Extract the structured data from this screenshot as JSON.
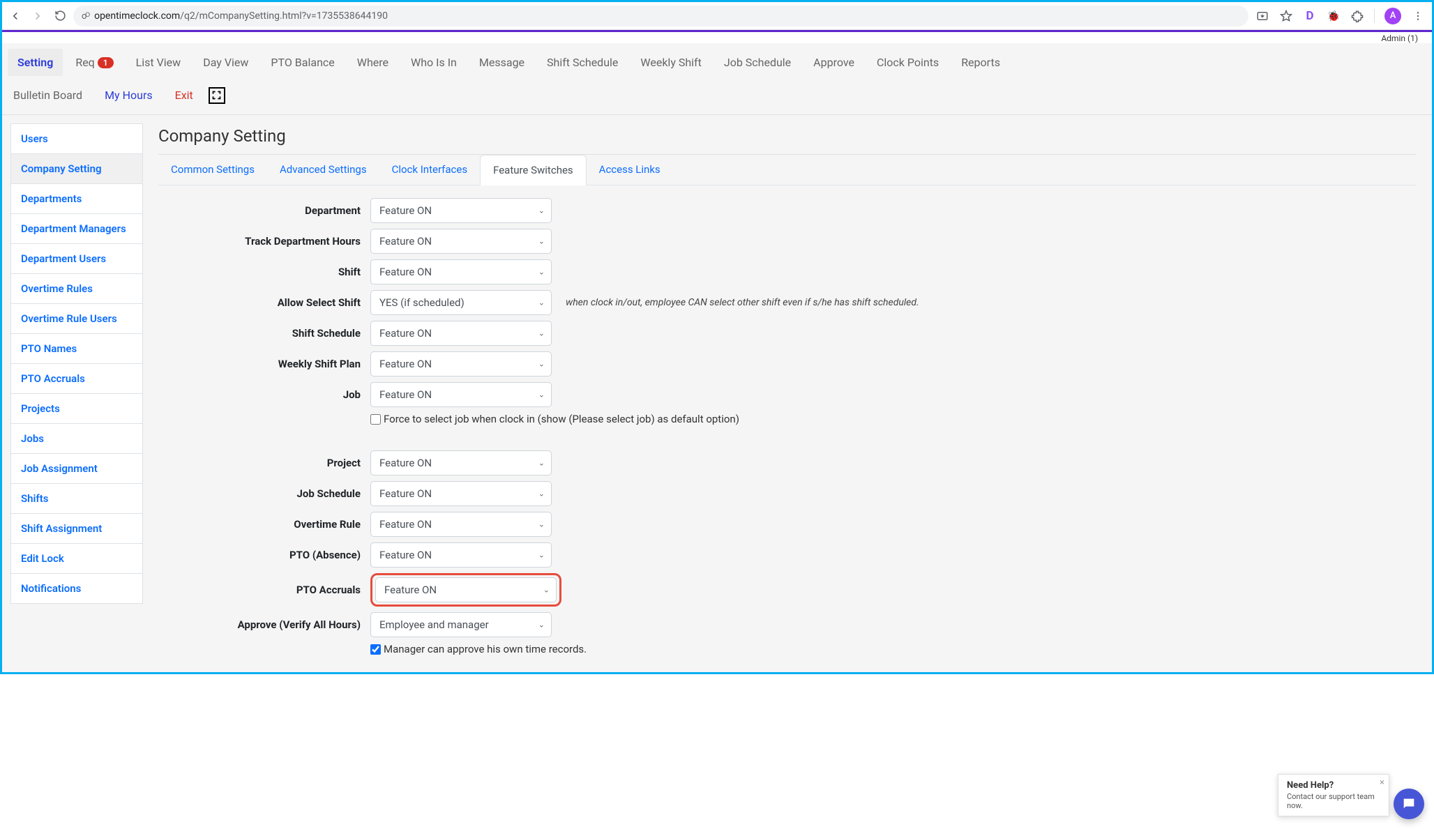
{
  "browser": {
    "url_domain": "opentimeclock.com",
    "url_path": "/q2/mCompanySetting.html?v=1735538644190",
    "avatar_letter": "A",
    "ext_d": "D",
    "admin_text": "Admin (1)"
  },
  "topnav": {
    "items": [
      {
        "label": "Setting"
      },
      {
        "label": "Req",
        "badge": "1"
      },
      {
        "label": "List View"
      },
      {
        "label": "Day View"
      },
      {
        "label": "PTO Balance"
      },
      {
        "label": "Where"
      },
      {
        "label": "Who Is In"
      },
      {
        "label": "Message"
      },
      {
        "label": "Shift Schedule"
      },
      {
        "label": "Weekly Shift"
      },
      {
        "label": "Job Schedule"
      },
      {
        "label": "Approve"
      },
      {
        "label": "Clock Points"
      },
      {
        "label": "Reports"
      },
      {
        "label": "Bulletin Board"
      },
      {
        "label": "My Hours"
      },
      {
        "label": "Exit"
      }
    ]
  },
  "sidebar": {
    "items": [
      "Users",
      "Company Setting",
      "Departments",
      "Department Managers",
      "Department Users",
      "Overtime Rules",
      "Overtime Rule Users",
      "PTO Names",
      "PTO Accruals",
      "Projects",
      "Jobs",
      "Job Assignment",
      "Shifts",
      "Shift Assignment",
      "Edit Lock",
      "Notifications"
    ]
  },
  "page": {
    "title": "Company Setting"
  },
  "tabs": {
    "items": [
      "Common Settings",
      "Advanced Settings",
      "Clock Interfaces",
      "Feature Switches",
      "Access Links"
    ]
  },
  "form": {
    "department_label": "Department",
    "department_value": "Feature ON",
    "track_hours_label": "Track Department Hours",
    "track_hours_value": "Feature ON",
    "shift_label": "Shift",
    "shift_value": "Feature ON",
    "allow_select_shift_label": "Allow Select Shift",
    "allow_select_shift_value": "YES (if scheduled)",
    "allow_select_shift_note": "when clock in/out, employee CAN select other shift even if s/he has shift scheduled.",
    "shift_schedule_label": "Shift Schedule",
    "shift_schedule_value": "Feature ON",
    "weekly_shift_plan_label": "Weekly Shift Plan",
    "weekly_shift_plan_value": "Feature ON",
    "job_label": "Job",
    "job_value": "Feature ON",
    "force_job_label": "Force to select job when clock in (show (Please select job) as default option)",
    "project_label": "Project",
    "project_value": "Feature ON",
    "job_schedule_label": "Job Schedule",
    "job_schedule_value": "Feature ON",
    "overtime_rule_label": "Overtime Rule",
    "overtime_rule_value": "Feature ON",
    "pto_absence_label": "PTO (Absence)",
    "pto_absence_value": "Feature ON",
    "pto_accruals_label": "PTO Accruals",
    "pto_accruals_value": "Feature ON",
    "approve_verify_label": "Approve (Verify All Hours)",
    "approve_verify_value": "Employee and manager",
    "manager_approve_label": "Manager can approve his own time records."
  },
  "help": {
    "title": "Need Help?",
    "text": "Contact our support team now."
  }
}
